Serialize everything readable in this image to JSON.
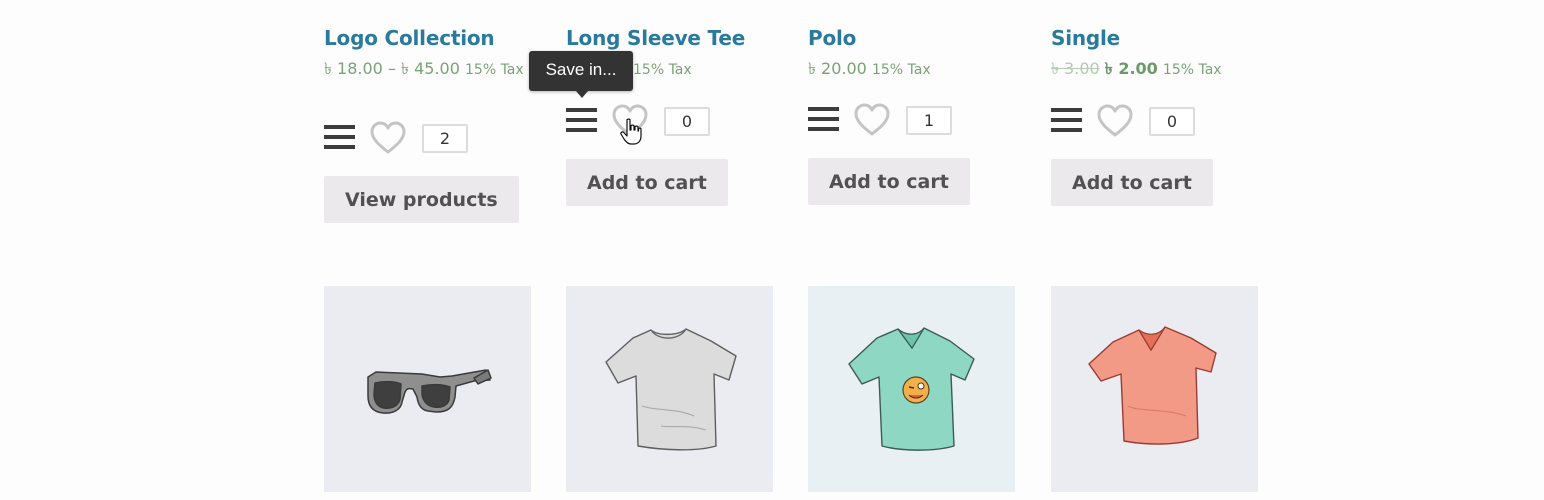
{
  "products": [
    {
      "title": "Logo Collection",
      "price": "৳ 18.00 – ৳ 45.00",
      "tax": "15% Tax",
      "wishlist_count": "2",
      "button_label": "View products",
      "image_icon": "sunglasses-icon"
    },
    {
      "title": "Long Sleeve Tee",
      "price": "",
      "tax": "15% Tax",
      "wishlist_count": "0",
      "button_label": "Add to cart",
      "image_icon": "tshirt-gray-icon"
    },
    {
      "title": "Polo",
      "price": "৳ 20.00",
      "tax": "15% Tax",
      "wishlist_count": "1",
      "button_label": "Add to cart",
      "image_icon": "tshirt-green-icon"
    },
    {
      "title": "Single",
      "price_regular": "৳ 3.00",
      "price_sale": "৳ 2.00",
      "tax": "15% Tax",
      "wishlist_count": "0",
      "button_label": "Add to cart",
      "image_icon": "tshirt-red-icon"
    }
  ],
  "tooltip": {
    "text": "Save in..."
  },
  "colors": {
    "title": "#2a7a9e",
    "price": "#7aa277",
    "button_bg": "#ebe9eb",
    "thumb_bg": "#eaecf1"
  }
}
